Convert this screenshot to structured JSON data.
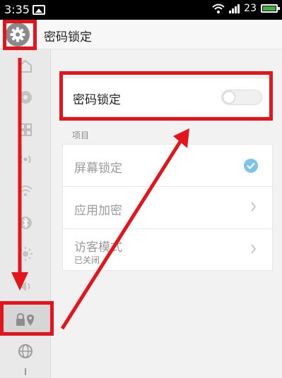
{
  "status_bar": {
    "time": "3:35",
    "battery_level": "23"
  },
  "header": {
    "title": "密码锁定"
  },
  "sidebar": {
    "items": [
      {
        "icon": "home-icon"
      },
      {
        "icon": "compass-icon"
      },
      {
        "icon": "grid-icon"
      },
      {
        "icon": "broadcast-icon"
      },
      {
        "icon": "wifi-icon"
      },
      {
        "icon": "bluetooth-icon"
      },
      {
        "icon": "brightness-icon"
      },
      {
        "icon": "volume-icon"
      },
      {
        "icon": "lock-location-icon",
        "active": true
      },
      {
        "icon": "globe-icon"
      }
    ]
  },
  "main": {
    "password_lock": {
      "label": "密码锁定",
      "enabled": false
    },
    "section_label": "项目",
    "items": [
      {
        "label": "屏幕锁定",
        "checked": true
      },
      {
        "label": "应用加密"
      },
      {
        "label": "访客模式",
        "subtitle": "已关闭"
      }
    ]
  },
  "colors": {
    "annotation": "#e3141b",
    "check": "#7fc4e8",
    "battery": "#3db33d"
  }
}
